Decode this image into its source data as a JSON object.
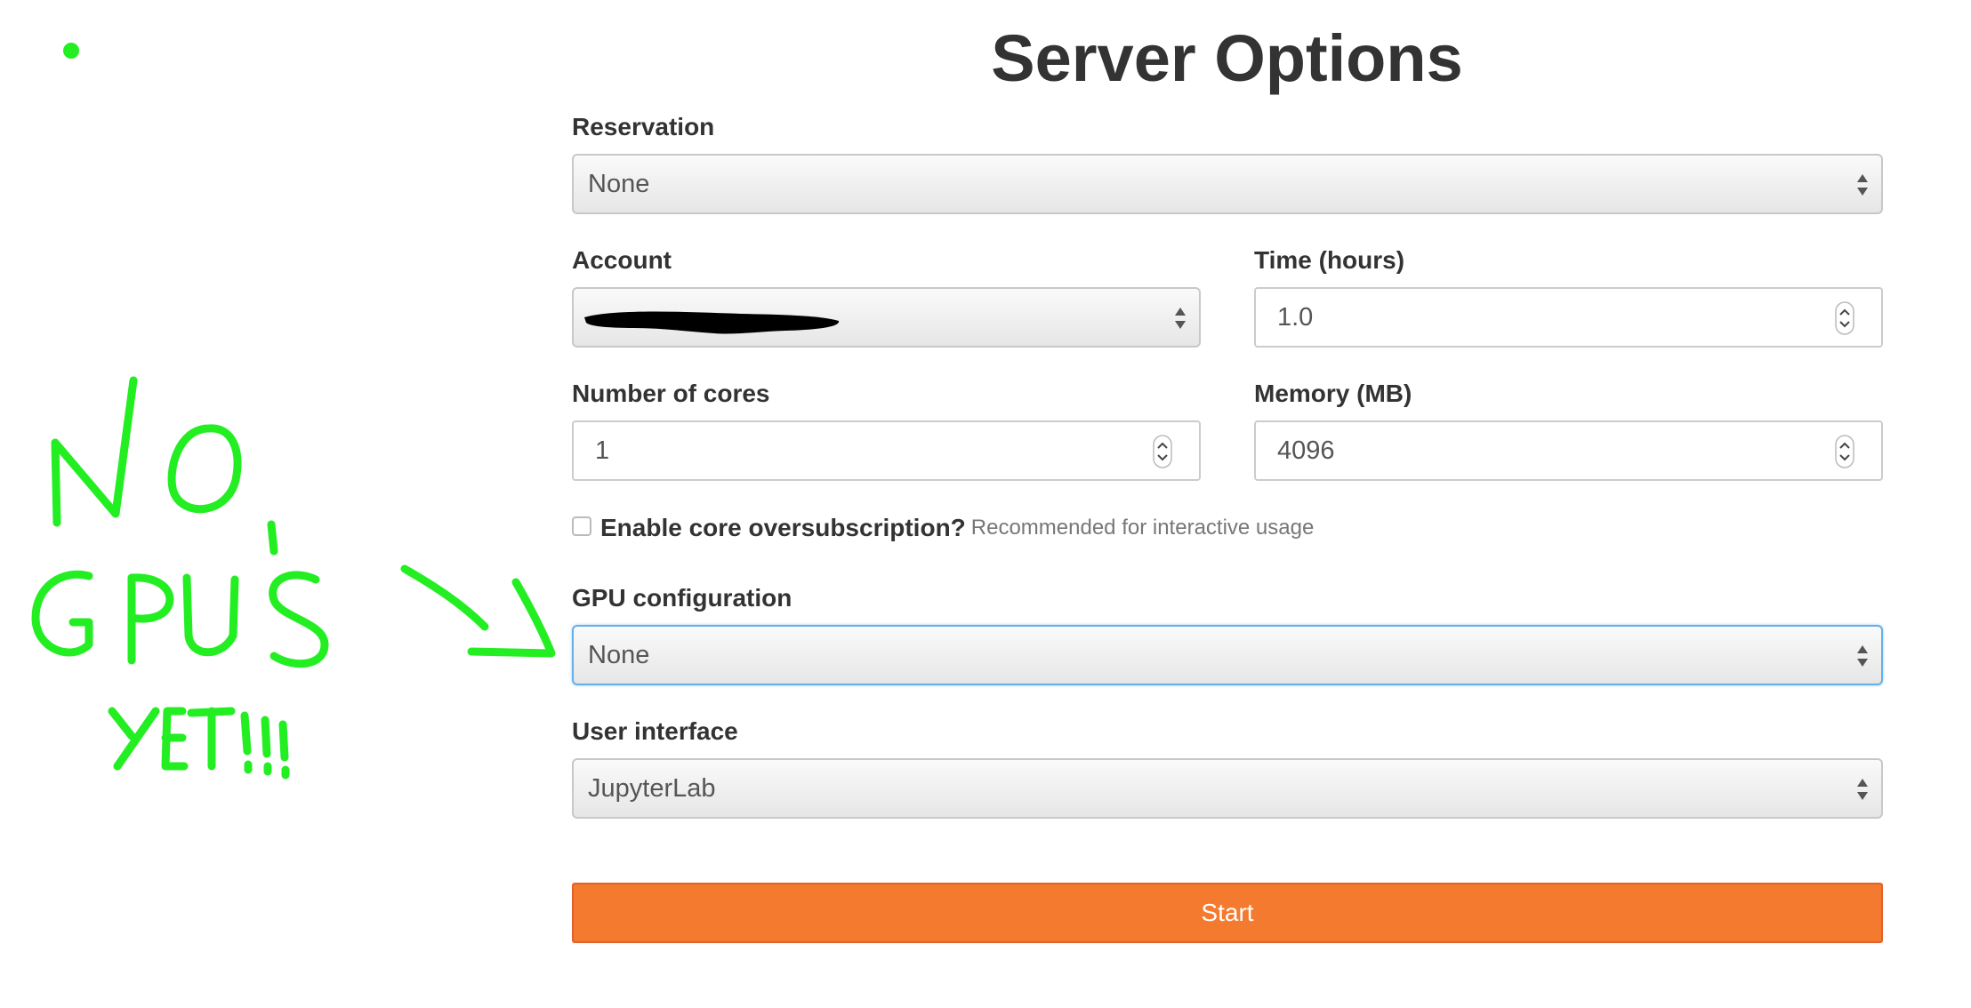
{
  "page": {
    "title": "Server Options"
  },
  "form": {
    "reservation": {
      "label": "Reservation",
      "value": "None"
    },
    "account": {
      "label": "Account",
      "value": ""
    },
    "time": {
      "label": "Time (hours)",
      "value": "1.0"
    },
    "cores": {
      "label": "Number of cores",
      "value": "1"
    },
    "memory": {
      "label": "Memory (MB)",
      "value": "4096"
    },
    "oversubscription": {
      "label": "Enable core oversubscription?",
      "help": "Recommended for interactive usage",
      "checked": false
    },
    "gpu": {
      "label": "GPU configuration",
      "value": "None"
    },
    "ui": {
      "label": "User interface",
      "value": "JupyterLab"
    },
    "start_label": "Start"
  },
  "annotation": {
    "text": "NO GPU'S YET!!!",
    "color": "#22ee22"
  },
  "colors": {
    "start_button": "#f37a2e",
    "focus_border": "#66afe9",
    "text": "#333333"
  }
}
